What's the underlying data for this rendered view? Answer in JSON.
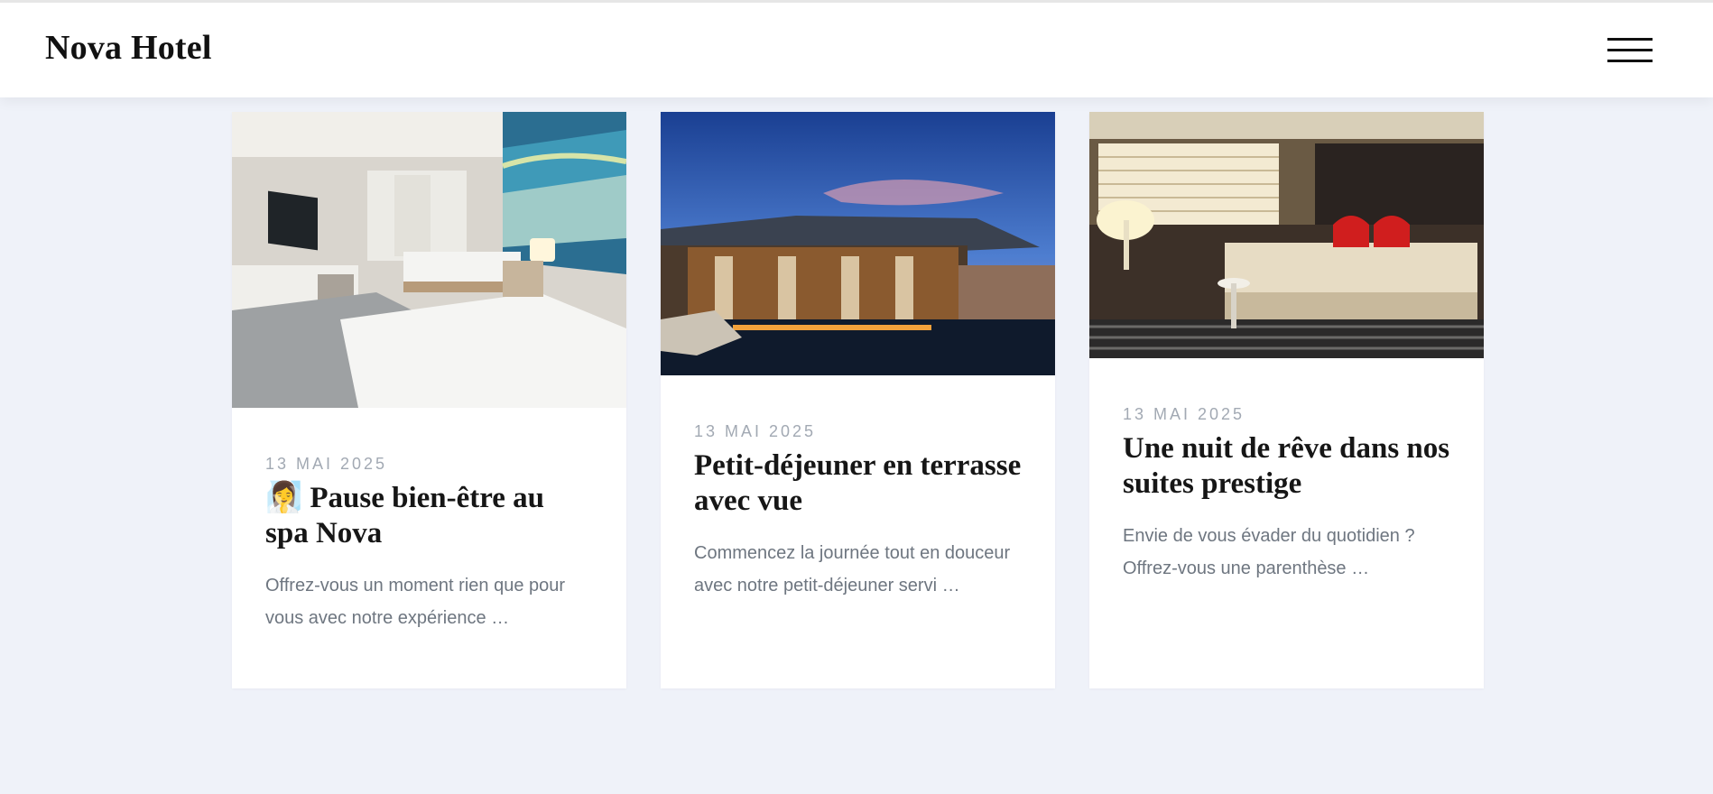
{
  "header": {
    "brand": "Nova Hotel",
    "menu_icon": "hamburger-menu-icon"
  },
  "posts": [
    {
      "date": "13 MAI 2025",
      "title": "🧖‍♀️ Pause bien-être au spa Nova",
      "excerpt": "Offrez-vous un moment rien que pour vous avec notre expérience …"
    },
    {
      "date": "13 MAI 2025",
      "title": "Petit-déjeuner en terrasse avec vue",
      "excerpt": "Commencez la journée tout en douceur avec notre petit-déjeuner servi …"
    },
    {
      "date": "13 MAI 2025",
      "title": "Une nuit de rêve dans nos suites prestige",
      "excerpt": "Envie de vous évader du quotidien ? Offrez-vous une parenthèse …"
    }
  ]
}
